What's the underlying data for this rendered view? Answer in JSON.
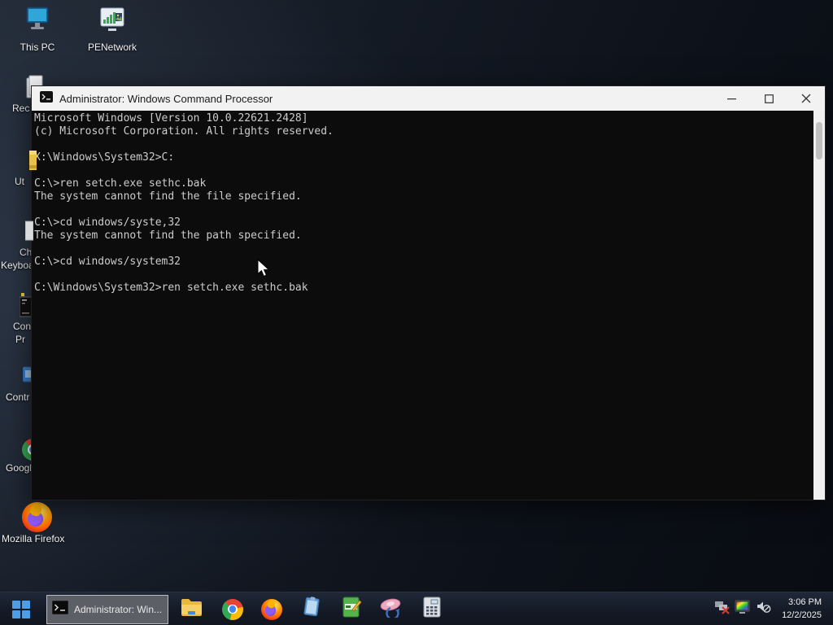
{
  "window": {
    "title": "Administrator: Windows Command Processor",
    "terminal_lines": [
      "Microsoft Windows [Version 10.0.22621.2428]",
      "(c) Microsoft Corporation. All rights reserved.",
      "",
      "X:\\Windows\\System32>C:",
      "",
      "C:\\>ren setch.exe sethc.bak",
      "The system cannot find the file specified.",
      "",
      "C:\\>cd windows/syste,32",
      "The system cannot find the path specified.",
      "",
      "C:\\>cd windows/system32",
      "",
      "C:\\Windows\\System32>ren setch.exe sethc.bak"
    ]
  },
  "desktop": {
    "top_icons": [
      {
        "label": "This PC"
      },
      {
        "label": "PENetwork"
      }
    ],
    "left_labels": {
      "recycle": "Rec",
      "utility": "Ut",
      "keyboard_line1": "Ch",
      "keyboard_line2": "Keyboa",
      "cmd_line1": "Con",
      "cmd_line2": "Pr",
      "control": "Contr",
      "chrome": "Googl",
      "firefox": "Mozilla Firefox"
    }
  },
  "taskbar": {
    "task_button_label": "Administrator: Win...",
    "clock": {
      "time": "3:06 PM",
      "date": "12/2/2025"
    }
  },
  "colors": {
    "terminal_bg": "#0c0c0c",
    "terminal_text": "#cccccc",
    "titlebar_bg": "#f2f2f2",
    "taskbar_bg": "#141a26",
    "accent_blue": "#4a9fe8"
  }
}
